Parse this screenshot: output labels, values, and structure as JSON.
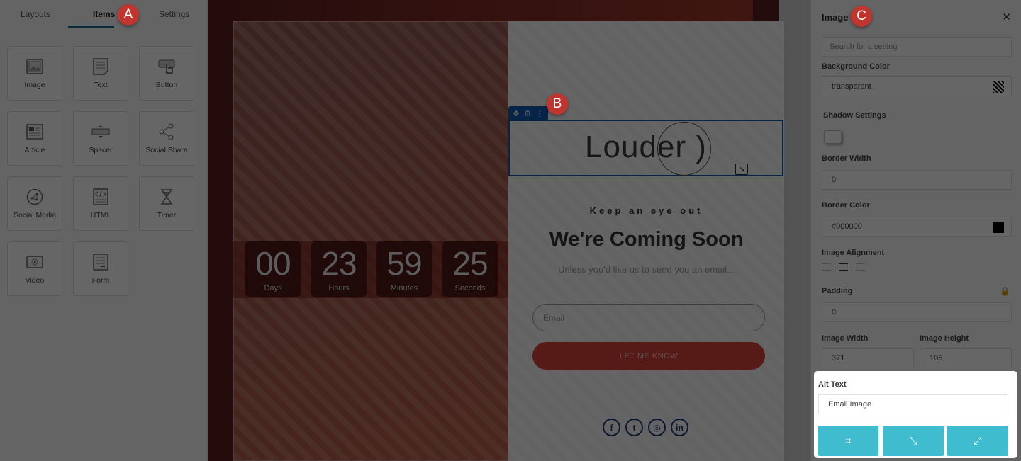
{
  "left_panel": {
    "tabs": [
      {
        "label": "Layouts",
        "active": false
      },
      {
        "label": "Items",
        "active": true
      },
      {
        "label": "Settings",
        "active": false
      }
    ],
    "items": [
      {
        "label": "Image",
        "icon": "image-icon"
      },
      {
        "label": "Text",
        "icon": "text-document-icon"
      },
      {
        "label": "Button",
        "icon": "button-click-icon"
      },
      {
        "label": "Article",
        "icon": "article-icon"
      },
      {
        "label": "Spacer",
        "icon": "spacer-icon"
      },
      {
        "label": "Social Share",
        "icon": "share-icon"
      },
      {
        "label": "Social Media",
        "icon": "social-network-icon"
      },
      {
        "label": "HTML",
        "icon": "code-icon"
      },
      {
        "label": "Timer",
        "icon": "hourglass-icon"
      },
      {
        "label": "Video",
        "icon": "video-play-icon"
      },
      {
        "label": "Form",
        "icon": "form-icon"
      }
    ]
  },
  "canvas": {
    "timer": [
      {
        "value": "00",
        "unit": "Days"
      },
      {
        "value": "23",
        "unit": "Hours"
      },
      {
        "value": "59",
        "unit": "Minutes"
      },
      {
        "value": "25",
        "unit": "Seconds"
      }
    ],
    "selected_image_text": "Louder )",
    "toolbar": {
      "move": "✥",
      "settings": "⚙",
      "more": "⋮"
    },
    "resize_glyph": "↘",
    "kicker": "Keep an eye out",
    "headline": "We're Coming Soon",
    "subline": "Unless you'd like us to send you an email...",
    "email_placeholder": "Email",
    "cta_label": "LET ME KNOW",
    "socials": [
      {
        "name": "facebook",
        "glyph": "f"
      },
      {
        "name": "twitter",
        "glyph": "t"
      },
      {
        "name": "instagram",
        "glyph": "◎"
      },
      {
        "name": "linkedin",
        "glyph": "in"
      }
    ]
  },
  "right_panel": {
    "title": "Image",
    "close_glyph": "✕",
    "search_placeholder": "Search for a setting",
    "background_color_label": "Background Color",
    "background_color_value": "transparent",
    "shadow_label": "Shadow Settings",
    "border_width_label": "Border Width",
    "border_width_value": "0",
    "border_color_label": "Border Color",
    "border_color_value": "#000000",
    "alignment_label": "Image Alignment",
    "alignment_selected": "center",
    "padding_label": "Padding",
    "padding_value": "0",
    "lock_glyph": "🔒",
    "width_label": "Image Width",
    "width_value": "371",
    "height_label": "Image Height",
    "height_value": "105",
    "alt_text_label": "Alt Text",
    "alt_text_value": "Email Image",
    "buttons": [
      {
        "name": "crop",
        "glyph": "⌗"
      },
      {
        "name": "shrink",
        "glyph": "⤡"
      },
      {
        "name": "expand",
        "glyph": "⤢"
      }
    ]
  },
  "annotations": {
    "a": "A",
    "b": "B",
    "c": "C"
  },
  "colors": {
    "accent_teal": "#3fbcce",
    "cta_red": "#d9453a",
    "selection_blue": "#1159b5",
    "badge_red": "#c0352d"
  }
}
